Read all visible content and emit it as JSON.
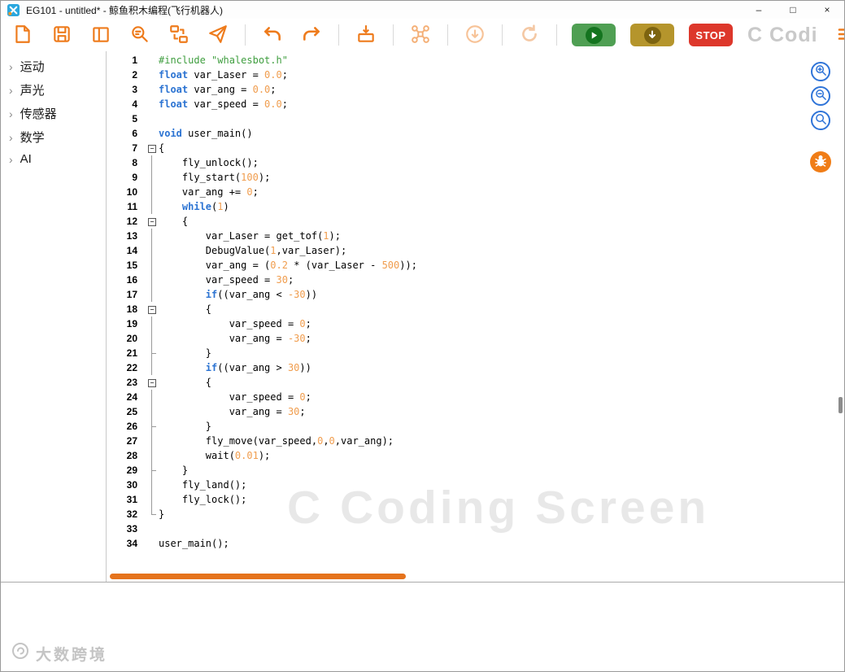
{
  "window": {
    "title": "EG101 - untitled* - 鲸鱼积木编程(飞行机器人)",
    "minimize": "–",
    "maximize": "□",
    "close": "×"
  },
  "toolbar": {
    "icons": [
      "new-file-icon",
      "save-icon",
      "layout-icon",
      "find-icon",
      "convert-icon",
      "send-icon",
      "undo-icon",
      "redo-icon",
      "flash-device-icon",
      "drone-icon",
      "download-icon",
      "refresh-icon",
      "play-icon",
      "device-download-icon",
      "menu-icon"
    ],
    "stop_label": "STOP",
    "watermark": "C Codi"
  },
  "sidebar": {
    "chevron": "›",
    "items": [
      {
        "key": "motion",
        "label": "运动"
      },
      {
        "key": "sound-light",
        "label": "声光"
      },
      {
        "key": "sensor",
        "label": "传感器"
      },
      {
        "key": "math",
        "label": "数学"
      },
      {
        "key": "ai",
        "label": "AI"
      }
    ]
  },
  "editor": {
    "watermark": "C Coding Screen",
    "lines": [
      {
        "n": 1,
        "fold": "",
        "seg": [
          [
            "s",
            "#include \"whalesbot.h\""
          ]
        ]
      },
      {
        "n": 2,
        "fold": "",
        "seg": [
          [
            "k",
            "float"
          ],
          [
            "p",
            " var_Laser = "
          ],
          [
            "num",
            "0.0"
          ],
          [
            "p",
            ";"
          ]
        ]
      },
      {
        "n": 3,
        "fold": "",
        "seg": [
          [
            "k",
            "float"
          ],
          [
            "p",
            " var_ang = "
          ],
          [
            "num",
            "0.0"
          ],
          [
            "p",
            ";"
          ]
        ]
      },
      {
        "n": 4,
        "fold": "",
        "seg": [
          [
            "k",
            "float"
          ],
          [
            "p",
            " var_speed = "
          ],
          [
            "num",
            "0.0"
          ],
          [
            "p",
            ";"
          ]
        ]
      },
      {
        "n": 5,
        "fold": "",
        "seg": []
      },
      {
        "n": 6,
        "fold": "",
        "seg": [
          [
            "k",
            "void"
          ],
          [
            "p",
            " user_main()"
          ]
        ]
      },
      {
        "n": 7,
        "fold": "box",
        "seg": [
          [
            "p",
            "{"
          ]
        ]
      },
      {
        "n": 8,
        "fold": "line",
        "seg": [
          [
            "p",
            "    fly_unlock();"
          ]
        ]
      },
      {
        "n": 9,
        "fold": "line",
        "seg": [
          [
            "p",
            "    fly_start("
          ],
          [
            "num",
            "100"
          ],
          [
            "p",
            ");"
          ]
        ]
      },
      {
        "n": 10,
        "fold": "line",
        "seg": [
          [
            "p",
            "    var_ang += "
          ],
          [
            "num",
            "0"
          ],
          [
            "p",
            ";"
          ]
        ]
      },
      {
        "n": 11,
        "fold": "line",
        "seg": [
          [
            "p",
            "    "
          ],
          [
            "k",
            "while"
          ],
          [
            "p",
            "("
          ],
          [
            "num",
            "1"
          ],
          [
            "p",
            ")"
          ]
        ]
      },
      {
        "n": 12,
        "fold": "box",
        "seg": [
          [
            "p",
            "    {"
          ]
        ]
      },
      {
        "n": 13,
        "fold": "line",
        "seg": [
          [
            "p",
            "        var_Laser = get_tof("
          ],
          [
            "num",
            "1"
          ],
          [
            "p",
            ");"
          ]
        ]
      },
      {
        "n": 14,
        "fold": "line",
        "seg": [
          [
            "p",
            "        DebugValue("
          ],
          [
            "num",
            "1"
          ],
          [
            "p",
            ",var_Laser);"
          ]
        ]
      },
      {
        "n": 15,
        "fold": "line",
        "seg": [
          [
            "p",
            "        var_ang = ("
          ],
          [
            "num",
            "0.2"
          ],
          [
            "p",
            " * (var_Laser - "
          ],
          [
            "num",
            "500"
          ],
          [
            "p",
            "));"
          ]
        ]
      },
      {
        "n": 16,
        "fold": "line",
        "seg": [
          [
            "p",
            "        var_speed = "
          ],
          [
            "num",
            "30"
          ],
          [
            "p",
            ";"
          ]
        ]
      },
      {
        "n": 17,
        "fold": "line",
        "seg": [
          [
            "p",
            "        "
          ],
          [
            "k",
            "if"
          ],
          [
            "p",
            "((var_ang < "
          ],
          [
            "num",
            "-30"
          ],
          [
            "p",
            "))"
          ]
        ]
      },
      {
        "n": 18,
        "fold": "box",
        "seg": [
          [
            "p",
            "        {"
          ]
        ]
      },
      {
        "n": 19,
        "fold": "line",
        "seg": [
          [
            "p",
            "            var_speed = "
          ],
          [
            "num",
            "0"
          ],
          [
            "p",
            ";"
          ]
        ]
      },
      {
        "n": 20,
        "fold": "line",
        "seg": [
          [
            "p",
            "            var_ang = "
          ],
          [
            "num",
            "-30"
          ],
          [
            "p",
            ";"
          ]
        ]
      },
      {
        "n": 21,
        "fold": "tick",
        "seg": [
          [
            "p",
            "        }"
          ]
        ]
      },
      {
        "n": 22,
        "fold": "line",
        "seg": [
          [
            "p",
            "        "
          ],
          [
            "k",
            "if"
          ],
          [
            "p",
            "((var_ang > "
          ],
          [
            "num",
            "30"
          ],
          [
            "p",
            "))"
          ]
        ]
      },
      {
        "n": 23,
        "fold": "box",
        "seg": [
          [
            "p",
            "        {"
          ]
        ]
      },
      {
        "n": 24,
        "fold": "line",
        "seg": [
          [
            "p",
            "            var_speed = "
          ],
          [
            "num",
            "0"
          ],
          [
            "p",
            ";"
          ]
        ]
      },
      {
        "n": 25,
        "fold": "line",
        "seg": [
          [
            "p",
            "            var_ang = "
          ],
          [
            "num",
            "30"
          ],
          [
            "p",
            ";"
          ]
        ]
      },
      {
        "n": 26,
        "fold": "tick",
        "seg": [
          [
            "p",
            "        }"
          ]
        ]
      },
      {
        "n": 27,
        "fold": "line",
        "seg": [
          [
            "p",
            "        fly_move(var_speed,"
          ],
          [
            "num",
            "0"
          ],
          [
            "p",
            ","
          ],
          [
            "num",
            "0"
          ],
          [
            "p",
            ",var_ang);"
          ]
        ]
      },
      {
        "n": 28,
        "fold": "line",
        "seg": [
          [
            "p",
            "        wait("
          ],
          [
            "num",
            "0.01"
          ],
          [
            "p",
            ");"
          ]
        ]
      },
      {
        "n": 29,
        "fold": "tick",
        "seg": [
          [
            "p",
            "    }"
          ]
        ]
      },
      {
        "n": 30,
        "fold": "line",
        "seg": [
          [
            "p",
            "    fly_land();"
          ]
        ]
      },
      {
        "n": 31,
        "fold": "line",
        "seg": [
          [
            "p",
            "    fly_lock();"
          ]
        ]
      },
      {
        "n": 32,
        "fold": "end",
        "seg": [
          [
            "p",
            "}"
          ]
        ]
      },
      {
        "n": 33,
        "fold": "",
        "seg": []
      },
      {
        "n": 34,
        "fold": "",
        "seg": [
          [
            "p",
            "user_main();"
          ]
        ]
      }
    ]
  },
  "footer": {
    "watermark": "大数跨境"
  }
}
